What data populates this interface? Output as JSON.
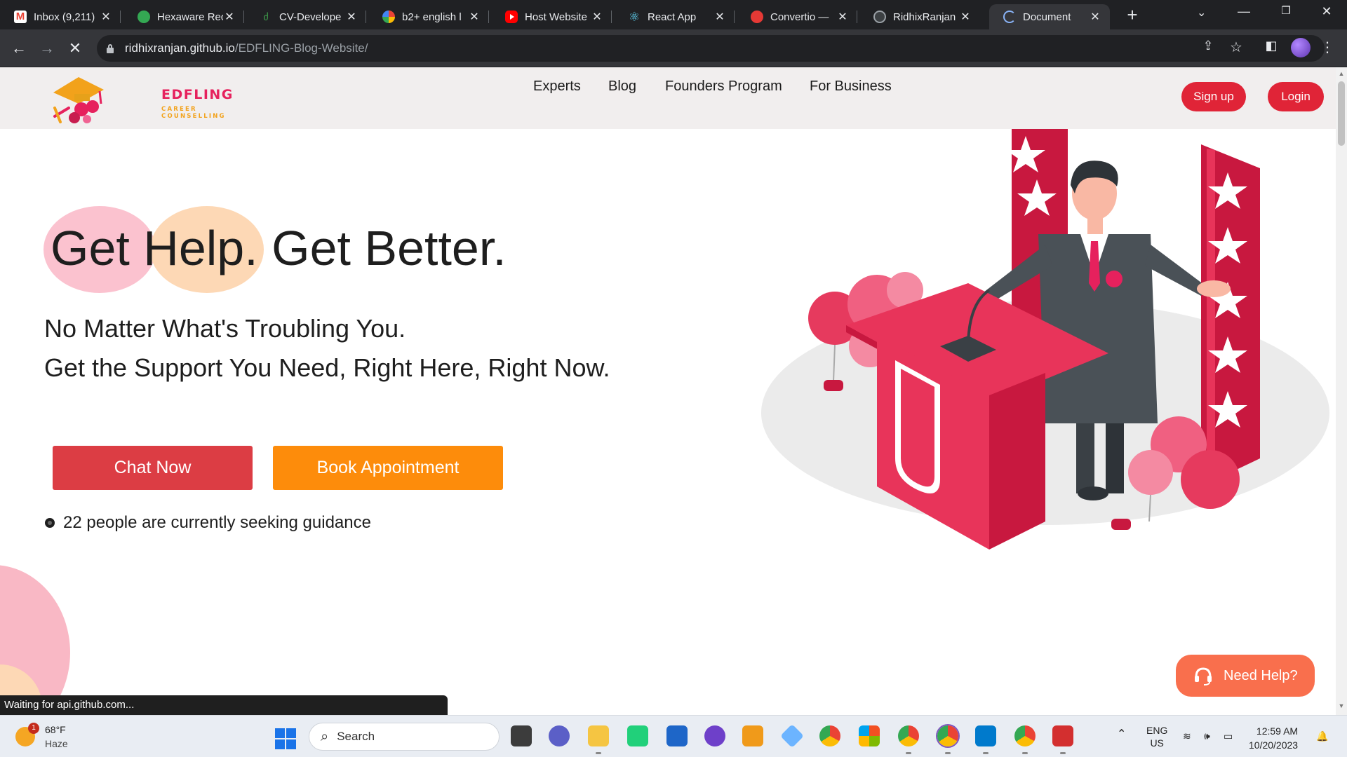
{
  "browser": {
    "tabs": [
      {
        "title": "Inbox (9,211)",
        "favicon": "gmail-icon",
        "color": "#ea4335"
      },
      {
        "title": "Hexaware Rec",
        "favicon": "hexaware-icon",
        "color": "#34a853"
      },
      {
        "title": "CV-Develope",
        "favicon": "cv-icon",
        "color": "#3fa34d"
      },
      {
        "title": "b2+ english l",
        "favicon": "google-icon",
        "color": "#4285f4"
      },
      {
        "title": "Host Website",
        "favicon": "youtube-icon",
        "color": "#ff0000"
      },
      {
        "title": "React App",
        "favicon": "react-icon",
        "color": "#61dafb"
      },
      {
        "title": "Convertio —",
        "favicon": "convertio-icon",
        "color": "#e53935"
      },
      {
        "title": "RidhixRanjan",
        "favicon": "github-icon",
        "color": "#9aa0a6"
      },
      {
        "title": "Document",
        "favicon": "loading-icon",
        "color": "#8ab4f8",
        "active": true
      }
    ],
    "url_host": "ridhixranjan.github.io",
    "url_path": "/EDFLING-Blog-Website/",
    "status_text": "Waiting for api.github.com..."
  },
  "site": {
    "logo_title": "EDFLING",
    "logo_subtitle": "CAREER COUNSELLING",
    "nav": [
      "Experts",
      "Blog",
      "Founders Program",
      "For Business"
    ],
    "signup_label": "Sign up",
    "login_label": "Login",
    "hero_title": "Get Help. Get Better.",
    "hero_line1": "No Matter What's Troubling You.",
    "hero_line2": "Get the Support You Need, Right Here, Right Now.",
    "chat_label": "Chat Now",
    "book_label": "Book Appointment",
    "seeking_text": "22 people are currently seeking guidance",
    "help_label": "Need Help?",
    "colors": {
      "accent_red": "#e02437",
      "chat_red": "#dc3d44",
      "book_orange": "#fd8c0b",
      "help_orange": "#f96f4d",
      "brand_pink": "#e6215d"
    }
  },
  "taskbar": {
    "weather_temp": "68°F",
    "weather_cond": "Haze",
    "weather_badge": "1",
    "search_label": "Search",
    "lang": "ENG",
    "region": "US",
    "time": "12:59 AM",
    "date": "10/20/2023"
  }
}
